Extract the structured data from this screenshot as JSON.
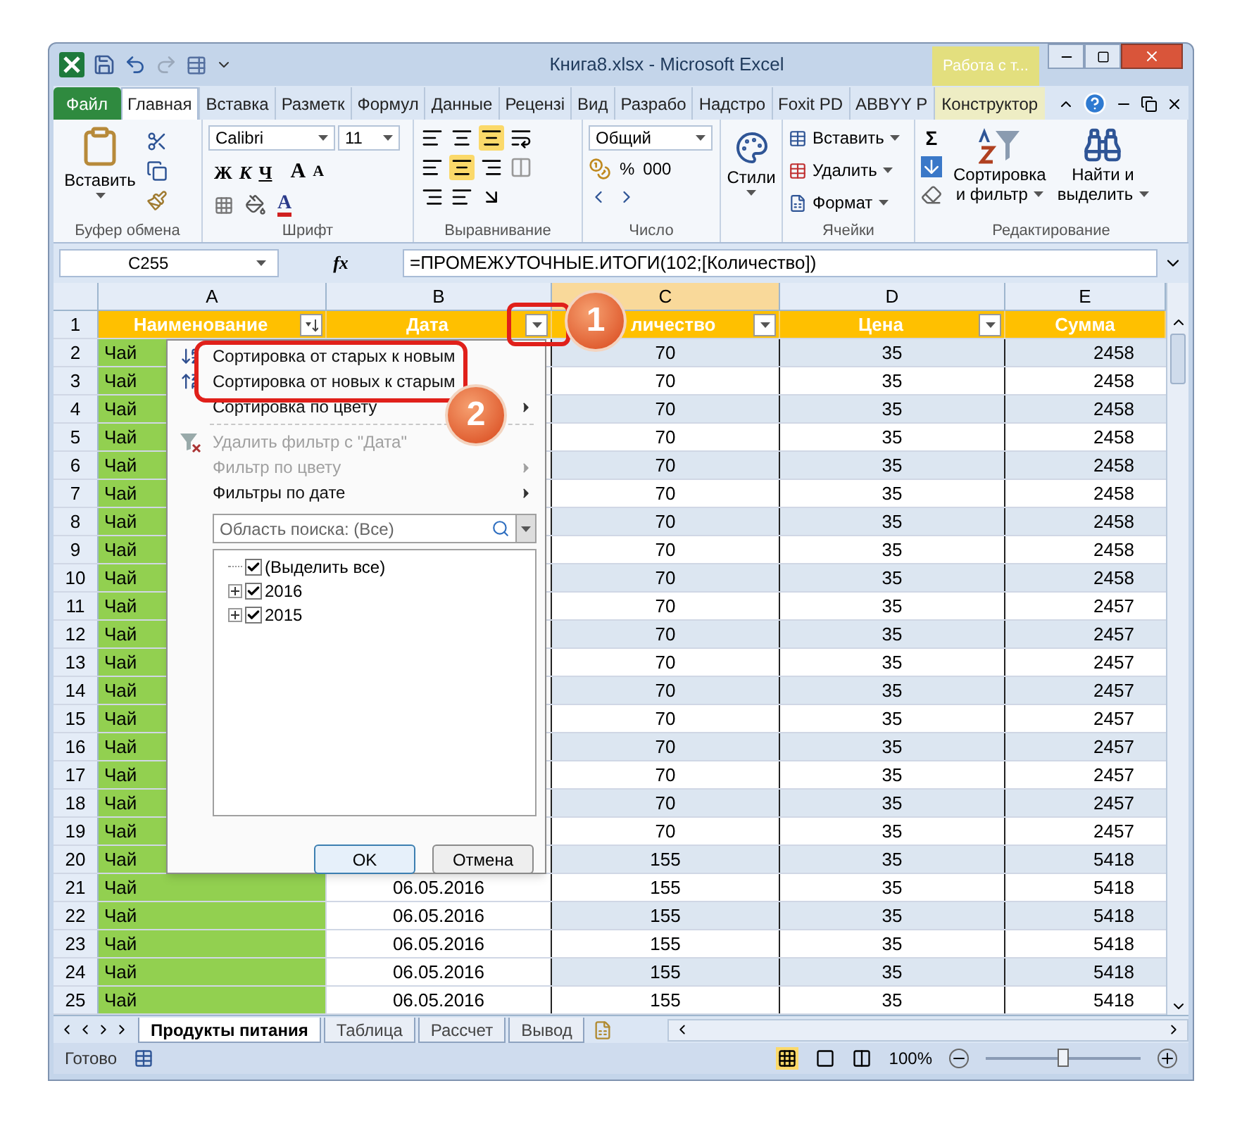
{
  "window": {
    "title": "Книга8.xlsx - Microsoft Excel",
    "context_tab": "Работа с т..."
  },
  "tabs": [
    {
      "label": "Файл",
      "kind": "file",
      "selected": false
    },
    {
      "label": "Главная",
      "kind": "tab",
      "selected": true
    },
    {
      "label": "Вставка",
      "kind": "tab",
      "selected": false
    },
    {
      "label": "Разметк",
      "kind": "tab",
      "selected": false
    },
    {
      "label": "Формул",
      "kind": "tab",
      "selected": false
    },
    {
      "label": "Данные",
      "kind": "tab",
      "selected": false
    },
    {
      "label": "Рецензі",
      "kind": "tab",
      "selected": false
    },
    {
      "label": "Вид",
      "kind": "tab",
      "selected": false
    },
    {
      "label": "Разрабо",
      "kind": "tab",
      "selected": false
    },
    {
      "label": "Надстро",
      "kind": "tab",
      "selected": false
    },
    {
      "label": "Foxit PD",
      "kind": "tab",
      "selected": false
    },
    {
      "label": "ABBYY P",
      "kind": "tab",
      "selected": false
    },
    {
      "label": "Конструктор",
      "kind": "context",
      "selected": false
    }
  ],
  "ribbon": {
    "clipboard": {
      "paste": "Вставить",
      "label": "Буфер обмена"
    },
    "font": {
      "name": "Calibri",
      "size": "11",
      "bold": "Ж",
      "italic": "К",
      "underline": "Ч",
      "grow": "A",
      "shrink": "A",
      "color_letter": "A",
      "label": "Шрифт"
    },
    "alignment": {
      "label": "Выравнивание"
    },
    "number": {
      "format": "Общий",
      "percent": "%",
      "thousands": "000",
      "label": "Число"
    },
    "styles": {
      "button": "Стили"
    },
    "cells": {
      "insert": "Вставить",
      "delete": "Удалить",
      "format": "Формат",
      "label": "Ячейки"
    },
    "editing": {
      "sum": "Σ",
      "sort": "Сортировка",
      "sort2": "и фильтр",
      "find": "Найти и",
      "find2": "выделить",
      "label": "Редактирование"
    }
  },
  "formula_bar": {
    "name_box": "C255",
    "fx": "fx",
    "formula": "=ПРОМЕЖУТОЧНЫЕ.ИТОГИ(102;[Количество])"
  },
  "columns": [
    {
      "letter": "A",
      "selected": false
    },
    {
      "letter": "B",
      "selected": false
    },
    {
      "letter": "C",
      "selected": true
    },
    {
      "letter": "D",
      "selected": false
    },
    {
      "letter": "E",
      "selected": false
    }
  ],
  "header": {
    "row": "1",
    "cells": [
      {
        "text": "Наименование",
        "kind": "sorted"
      },
      {
        "text": "Дата",
        "kind": "filter"
      },
      {
        "text": "личество",
        "kind": "covered"
      },
      {
        "text": "Цена",
        "kind": "filter"
      },
      {
        "text": "Сумма",
        "kind": "plain"
      }
    ]
  },
  "rows": [
    {
      "n": "2",
      "a": "Чай",
      "c": "70",
      "d": "35",
      "e": "2458"
    },
    {
      "n": "3",
      "a": "Чай",
      "c": "70",
      "d": "35",
      "e": "2458"
    },
    {
      "n": "4",
      "a": "Чай",
      "c": "70",
      "d": "35",
      "e": "2458"
    },
    {
      "n": "5",
      "a": "Чай",
      "c": "70",
      "d": "35",
      "e": "2458"
    },
    {
      "n": "6",
      "a": "Чай",
      "c": "70",
      "d": "35",
      "e": "2458"
    },
    {
      "n": "7",
      "a": "Чай",
      "c": "70",
      "d": "35",
      "e": "2458"
    },
    {
      "n": "8",
      "a": "Чай",
      "c": "70",
      "d": "35",
      "e": "2458"
    },
    {
      "n": "9",
      "a": "Чай",
      "c": "70",
      "d": "35",
      "e": "2458"
    },
    {
      "n": "10",
      "a": "Чай",
      "c": "70",
      "d": "35",
      "e": "2458"
    },
    {
      "n": "11",
      "a": "Чай",
      "c": "70",
      "d": "35",
      "e": "2457"
    },
    {
      "n": "12",
      "a": "Чай",
      "c": "70",
      "d": "35",
      "e": "2457"
    },
    {
      "n": "13",
      "a": "Чай",
      "c": "70",
      "d": "35",
      "e": "2457"
    },
    {
      "n": "14",
      "a": "Чай",
      "c": "70",
      "d": "35",
      "e": "2457"
    },
    {
      "n": "15",
      "a": "Чай",
      "c": "70",
      "d": "35",
      "e": "2457"
    },
    {
      "n": "16",
      "a": "Чай",
      "c": "70",
      "d": "35",
      "e": "2457"
    },
    {
      "n": "17",
      "a": "Чай",
      "c": "70",
      "d": "35",
      "e": "2457"
    },
    {
      "n": "18",
      "a": "Чай",
      "c": "70",
      "d": "35",
      "e": "2457"
    },
    {
      "n": "19",
      "a": "Чай",
      "c": "70",
      "d": "35",
      "e": "2457"
    },
    {
      "n": "20",
      "a": "Чай",
      "c": "155",
      "d": "35",
      "e": "5418"
    },
    {
      "n": "21",
      "a": "Чай",
      "b": "06.05.2016",
      "c": "155",
      "d": "35",
      "e": "5418"
    },
    {
      "n": "22",
      "a": "Чай",
      "b": "06.05.2016",
      "c": "155",
      "d": "35",
      "e": "5418"
    },
    {
      "n": "23",
      "a": "Чай",
      "b": "06.05.2016",
      "c": "155",
      "d": "35",
      "e": "5418"
    },
    {
      "n": "24",
      "a": "Чай",
      "b": "06.05.2016",
      "c": "155",
      "d": "35",
      "e": "5418"
    },
    {
      "n": "25",
      "a": "Чай",
      "b": "06.05.2016",
      "c": "155",
      "d": "35",
      "e": "5418"
    }
  ],
  "filter_menu": {
    "items": [
      {
        "kind": "ascending",
        "label": "Сортировка от старых к новым",
        "disabled": false,
        "submenu": false
      },
      {
        "kind": "descending",
        "label": "Сортировка от новых к старым",
        "disabled": false,
        "submenu": false
      },
      {
        "kind": "plain",
        "label": "Сортировка по цвету",
        "disabled": false,
        "submenu": true
      },
      {
        "kind": "separator"
      },
      {
        "kind": "clear",
        "label": "Удалить фильтр с \"Дата\"",
        "disabled": true,
        "submenu": false
      },
      {
        "kind": "plain",
        "label": "Фильтр по цвету",
        "disabled": true,
        "submenu": true
      },
      {
        "kind": "plain",
        "label": "Фильтры по дате",
        "disabled": false,
        "submenu": true
      }
    ],
    "search": {
      "placeholder": "Область поиска: (Все)"
    },
    "tree": [
      {
        "label": "(Выделить все)",
        "checked": true
      },
      {
        "label": "2016",
        "checked": true,
        "expanded": false
      },
      {
        "label": "2015",
        "checked": true,
        "expanded": false
      }
    ],
    "buttons": [
      "OK",
      "Отмена"
    ]
  },
  "annotations": [
    {
      "kind": "badge",
      "text": "1"
    },
    {
      "kind": "badge",
      "text": "2"
    }
  ],
  "sheet_tabs": [
    {
      "label": "Продукты питания",
      "selected": true
    },
    {
      "label": "Таблица",
      "selected": false
    },
    {
      "label": "Рассчет",
      "selected": false
    },
    {
      "label": "Вывод",
      "selected": false
    }
  ],
  "status_bar": {
    "text": "Готово",
    "zoom": "100%",
    "level": 0.5
  }
}
